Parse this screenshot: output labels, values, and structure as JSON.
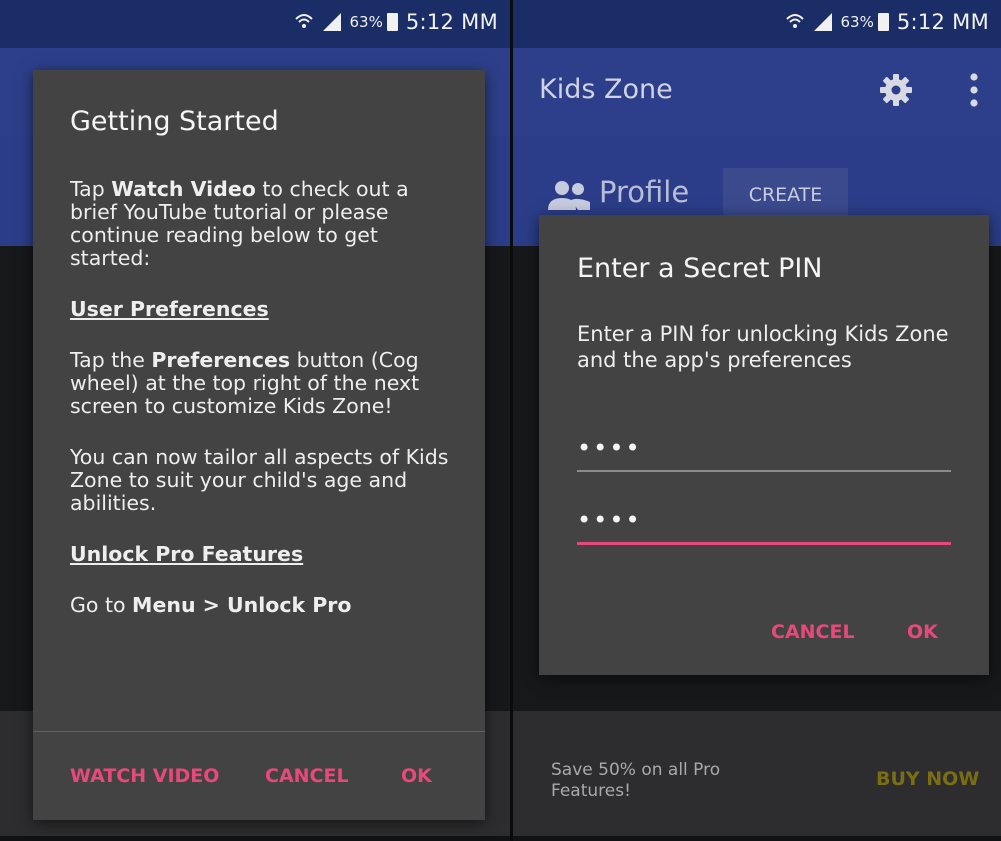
{
  "status_bar": {
    "battery_percent": "63%",
    "time": "5:12 MM"
  },
  "left_screen": {
    "dialog": {
      "title": "Getting Started",
      "intro_before": "Tap ",
      "intro_bold": "Watch Video",
      "intro_after": " to check out a brief YouTube tutorial or please continue reading below to get started:",
      "section1_title": "User Preferences",
      "pref_before": "Tap the ",
      "pref_bold": "Preferences",
      "pref_after": " button (Cog wheel) at the top right of the next screen to customize Kids Zone!",
      "tailor_text": "You can now tailor all aspects of Kids Zone to suit your child's age and abilities.",
      "section2_title": "Unlock Pro Features",
      "goto_before": "Go to ",
      "goto_bold1": "Menu",
      "goto_mid": " > ",
      "goto_bold2": "Unlock Pro",
      "actions": {
        "watch_video": "WATCH VIDEO",
        "cancel": "CANCEL",
        "ok": "OK"
      }
    }
  },
  "right_screen": {
    "app_title": "Kids Zone",
    "profile_label": "Profile",
    "create_label": "CREATE",
    "dialog": {
      "title": "Enter a Secret PIN",
      "description": "Enter a PIN for unlocking Kids Zone and the app's preferences",
      "pin_value_1": "••••",
      "pin_value_2": "••••",
      "actions": {
        "cancel": "CANCEL",
        "ok": "OK"
      }
    },
    "promo_text": "Save 50% on all Pro Features!",
    "buy_now": "BUY NOW"
  },
  "colors": {
    "accent": "#e8497c",
    "dialog_bg": "#434344",
    "app_bar": "#2d3f8a",
    "status_bar": "#1b2d66",
    "buy_now": "#7b6e12"
  },
  "icons": [
    "wifi-icon",
    "signal-icon",
    "battery-icon",
    "gear-icon",
    "overflow-menu-icon",
    "people-icon"
  ]
}
